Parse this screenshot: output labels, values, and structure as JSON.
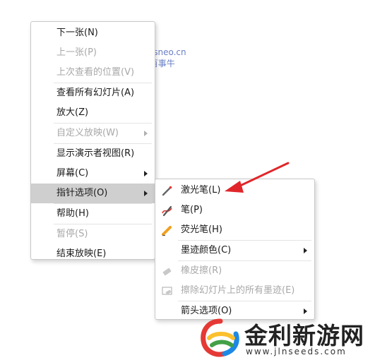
{
  "watermark": {
    "url": "passneo.cn",
    "name": "百事牛"
  },
  "main_menu": {
    "items": [
      {
        "label": "下一张(N)",
        "disabled": false
      },
      {
        "label": "上一张(P)",
        "disabled": true
      },
      {
        "label": "上次查看的位置(V)",
        "disabled": true
      },
      {
        "label": "查看所有幻灯片(A)",
        "disabled": false
      },
      {
        "label": "放大(Z)",
        "disabled": false
      },
      {
        "label": "自定义放映(W)",
        "disabled": true
      },
      {
        "label": "显示演示者视图(R)",
        "disabled": false
      },
      {
        "label": "屏幕(C)",
        "disabled": false
      },
      {
        "label": "指针选项(O)",
        "disabled": false,
        "active": true
      },
      {
        "label": "帮助(H)",
        "disabled": false
      },
      {
        "label": "暂停(S)",
        "disabled": true
      },
      {
        "label": "结束放映(E)",
        "disabled": false
      }
    ]
  },
  "sub_menu": {
    "items": [
      {
        "label": "激光笔(L)",
        "icon": "laser-pointer-icon",
        "disabled": false
      },
      {
        "label": "笔(P)",
        "icon": "pen-icon",
        "disabled": false
      },
      {
        "label": "荧光笔(H)",
        "icon": "highlighter-icon",
        "disabled": false
      },
      {
        "label": "墨迹颜色(C)",
        "disabled": false
      },
      {
        "label": "橡皮擦(R)",
        "icon": "eraser-icon",
        "disabled": true
      },
      {
        "label": "擦除幻灯片上的所有墨迹(E)",
        "icon": "erase-all-icon",
        "disabled": true
      },
      {
        "label": "箭头选项(O)",
        "disabled": false
      }
    ]
  },
  "brand": {
    "name": "金利新游网",
    "url": "www.jlnseeds.com"
  },
  "colors": {
    "annotation_arrow": "#e0262a",
    "hover": "#cfcfcf",
    "watermark": "#6a7fc4"
  }
}
